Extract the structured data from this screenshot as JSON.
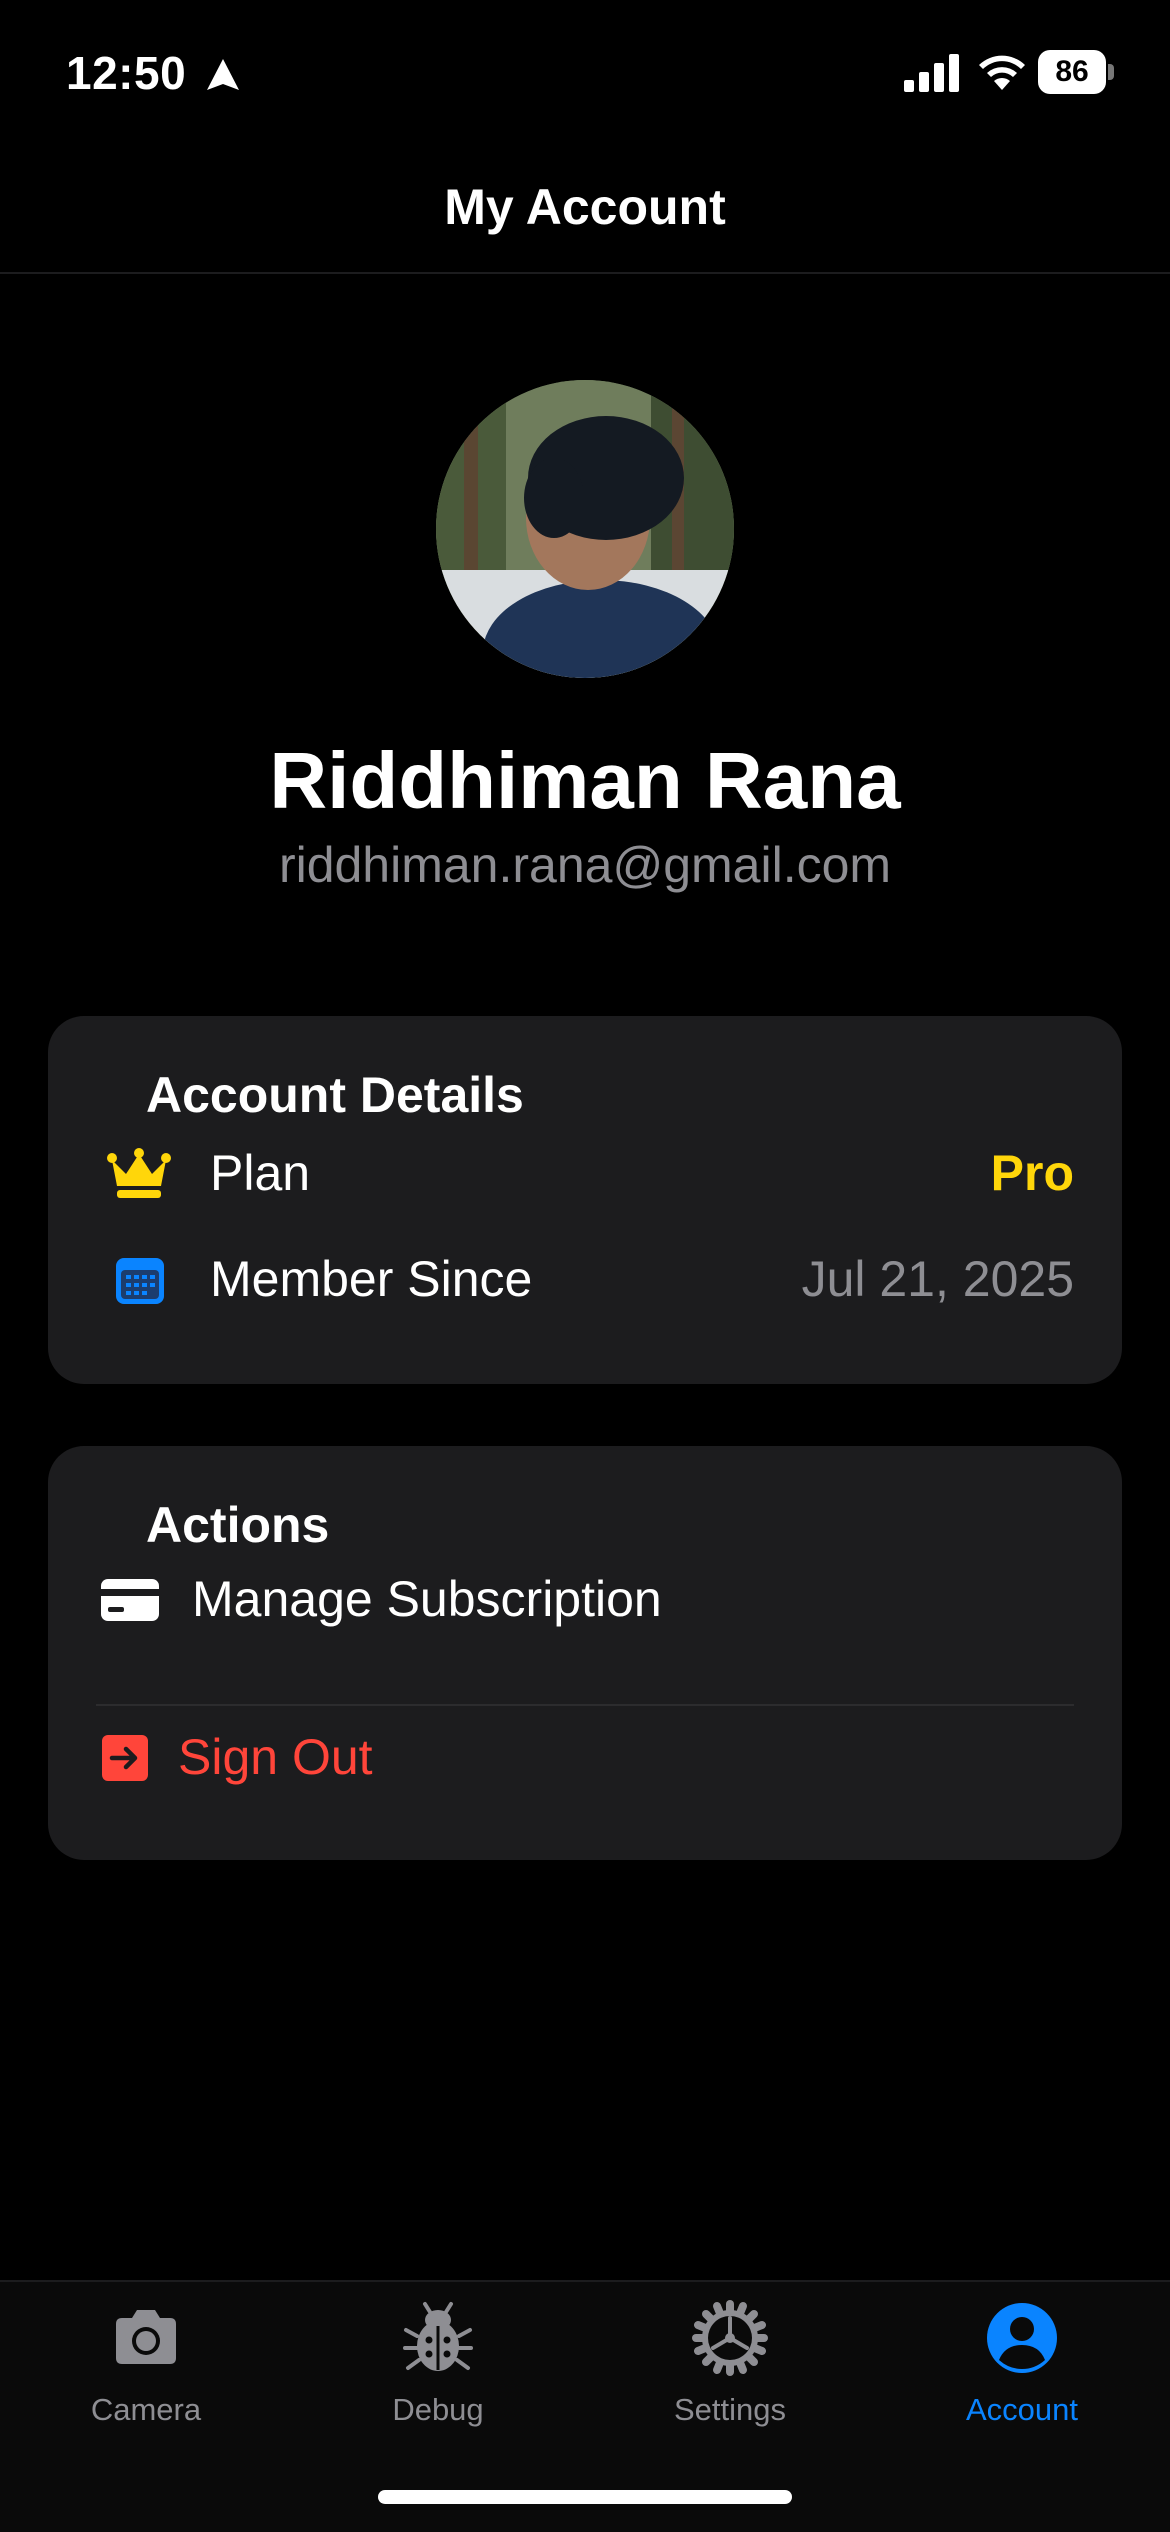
{
  "status_bar": {
    "time": "12:50",
    "battery_level": "86",
    "icons": [
      "location-icon",
      "signal-icon",
      "wifi-icon",
      "battery-icon"
    ]
  },
  "nav": {
    "title": "My Account"
  },
  "profile": {
    "name": "Riddhiman Rana",
    "email": "riddhiman.rana@gmail.com"
  },
  "account_details": {
    "title": "Account Details",
    "rows": [
      {
        "icon": "crown-icon",
        "label": "Plan",
        "value": "Pro",
        "value_color": "#ffd60a"
      },
      {
        "icon": "calendar-icon",
        "label": "Member Since",
        "value": "Jul 21, 2025",
        "value_color": "#8e8e93"
      }
    ]
  },
  "actions": {
    "title": "Actions",
    "items": [
      {
        "icon": "credit-card-icon",
        "label": "Manage Subscription"
      },
      {
        "icon": "sign-out-icon",
        "label": "Sign Out",
        "color": "#ff453a"
      }
    ]
  },
  "tab_bar": {
    "tabs": [
      {
        "icon": "camera-icon",
        "label": "Camera",
        "active": false
      },
      {
        "icon": "bug-icon",
        "label": "Debug",
        "active": false
      },
      {
        "icon": "gear-icon",
        "label": "Settings",
        "active": false
      },
      {
        "icon": "person-circle-icon",
        "label": "Account",
        "active": true
      }
    ],
    "active_color": "#0a84ff",
    "inactive_color": "#8e8e93"
  }
}
